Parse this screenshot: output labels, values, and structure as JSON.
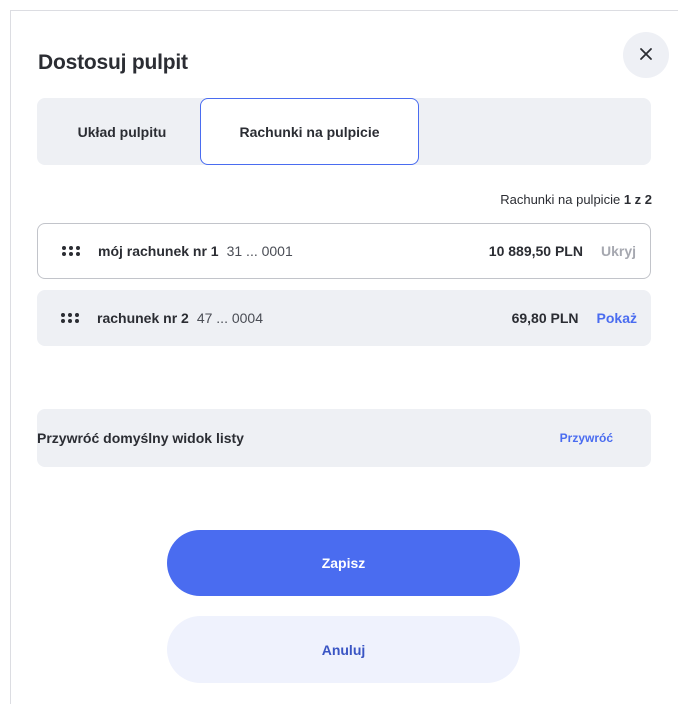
{
  "dialog": {
    "title": "Dostosuj pulpit",
    "close_icon": "close-icon"
  },
  "tabs": [
    {
      "label": "Układ pulpitu",
      "active": false
    },
    {
      "label": "Rachunki na pulpicie",
      "active": true
    }
  ],
  "accounts_count": {
    "prefix": "Rachunki na pulpicie",
    "value": "1 z 2"
  },
  "accounts": [
    {
      "name": "mój rachunek nr 1",
      "number": "31 ... 0001",
      "balance": "10 889,50 PLN",
      "action": "Ukryj",
      "visible": true
    },
    {
      "name": "rachunek nr 2",
      "number": "47 ... 0004",
      "balance": "69,80 PLN",
      "action": "Pokaż",
      "visible": false
    }
  ],
  "restore": {
    "label": "Przywróć domyślny widok listy",
    "button": "Przywróć"
  },
  "buttons": {
    "save": "Zapisz",
    "cancel": "Anuluj"
  },
  "colors": {
    "accent": "#4a6cf0",
    "panel": "#eef0f4",
    "muted_action": "#a6a8b0"
  }
}
